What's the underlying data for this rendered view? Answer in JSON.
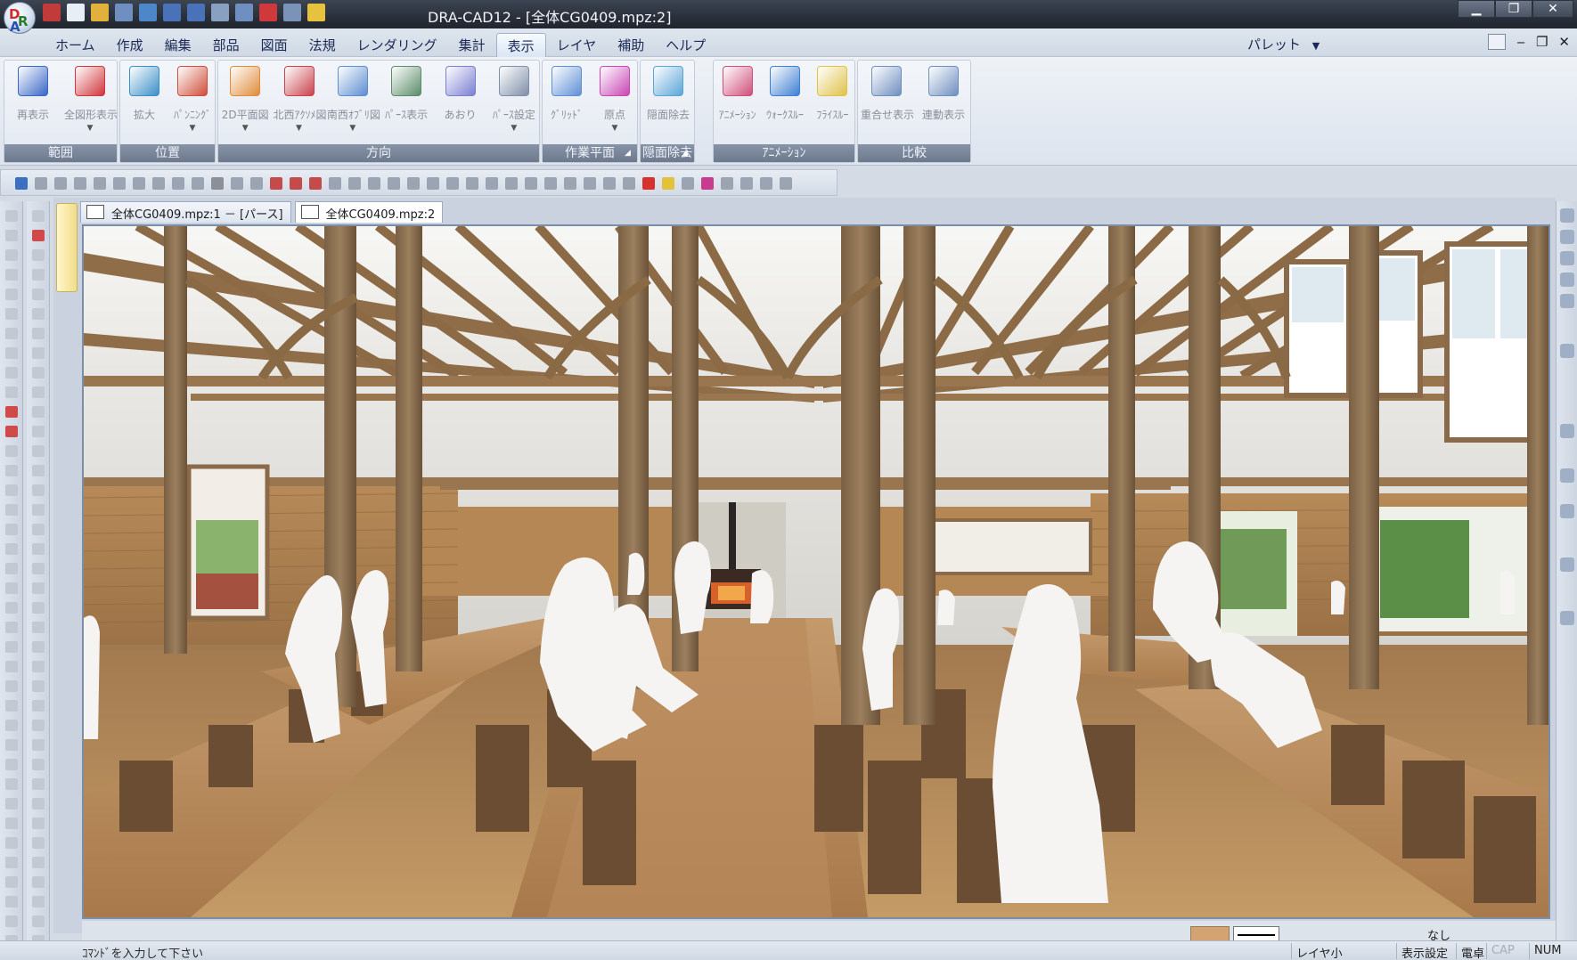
{
  "window": {
    "title": "DRA-CAD12 - [全体CG0409.mpz:2]",
    "logo_letters": [
      "D",
      "R",
      "A"
    ]
  },
  "quick_access": [
    "3d-icon",
    "new-icon",
    "open-icon",
    "save-icon",
    "print-preview-icon",
    "undo-icon",
    "redo-icon",
    "cut-icon",
    "copy-icon",
    "stop-icon",
    "paste-icon",
    "note-icon"
  ],
  "menu": {
    "tabs": [
      "ホーム",
      "作成",
      "編集",
      "部品",
      "図面",
      "法規",
      "レンダリング",
      "集計",
      "表示",
      "レイヤ",
      "補助",
      "ヘルプ"
    ],
    "active_tab": "表示",
    "palette_label": "パレット",
    "palette_arrow": "▼"
  },
  "mdi_controls": {
    "minimize": "‒",
    "restore": "❐",
    "close": "✕"
  },
  "window_controls": {
    "minimize": "▁",
    "maximize": "❐",
    "close": "✕"
  },
  "ribbon": {
    "groups": [
      {
        "label": "範囲",
        "buttons": [
          {
            "label": "再表示",
            "icon": "monitor-blue-icon",
            "color": "#3a67c6",
            "dropdown": false
          },
          {
            "label": "全図形表示",
            "icon": "monitor-red-icon",
            "color": "#d0353b",
            "dropdown": true
          }
        ]
      },
      {
        "label": "位置",
        "buttons": [
          {
            "label": "拡大",
            "icon": "zoom-box-icon",
            "color": "#3b8fc7",
            "dropdown": false
          },
          {
            "label": "ﾊﾟﾝﾆﾝｸﾞ",
            "icon": "pan-arrow-icon",
            "color": "#d04d3a",
            "dropdown": true
          }
        ]
      },
      {
        "label": "方向",
        "buttons": [
          {
            "label": "2D平面図",
            "icon": "2d-plan-icon",
            "color": "#e08c3a",
            "dropdown": true
          },
          {
            "label": "北西ｱｸｿﾒ図",
            "icon": "nw-axonometric-icon",
            "color": "#c9424b",
            "dropdown": true
          },
          {
            "label": "南西ｵﾌﾞﾘ図",
            "icon": "sw-oblique-icon",
            "color": "#5d8ed1",
            "dropdown": true
          },
          {
            "label": "ﾊﾟｰｽ表示",
            "icon": "perspective-icon",
            "color": "#5b8c6a",
            "dropdown": false
          },
          {
            "label": "あおり",
            "icon": "tilt-icon",
            "color": "#7a7fd0",
            "dropdown": false
          },
          {
            "label": "ﾊﾟｰｽ設定",
            "icon": "perspective-settings-icon",
            "color": "#7f8fa8",
            "dropdown": true
          }
        ]
      },
      {
        "label": "作業平面",
        "buttons": [
          {
            "label": "ｸﾞﾘｯﾄﾞ",
            "icon": "grid-icon",
            "color": "#5f8fd6",
            "dropdown": false
          },
          {
            "label": "原点",
            "icon": "origin-axes-icon",
            "color": "#c945b5",
            "dropdown": true
          }
        ]
      },
      {
        "label": "隠面除去",
        "buttons": [
          {
            "label": "隠面除去",
            "icon": "hidden-surface-icon",
            "color": "#5aa5d8",
            "dropdown": false
          }
        ]
      },
      {
        "label": "ｱﾆﾒｰｼｮﾝ",
        "buttons": [
          {
            "label": "ｱﾆﾒｰｼｮﾝ",
            "icon": "animation-camera-icon",
            "color": "#d04f7a",
            "dropdown": false
          },
          {
            "label": "ｳｫｰｸｽﾙｰ",
            "icon": "walkthrough-icon",
            "color": "#3d7fd2",
            "dropdown": false
          },
          {
            "label": "ﾌﾗｲｽﾙｰ",
            "icon": "flythrough-icon",
            "color": "#e0c24a",
            "dropdown": false
          }
        ]
      },
      {
        "label": "比較",
        "buttons": [
          {
            "label": "重合せ表示",
            "icon": "overlay-icon",
            "color": "#6f8fbf",
            "dropdown": false
          },
          {
            "label": "連動表示",
            "icon": "linked-view-icon",
            "color": "#6f8fbf",
            "dropdown": false
          }
        ]
      }
    ]
  },
  "documents": {
    "tabs": [
      {
        "label": "全体CG0409.mpz:1 － [パース]",
        "active": false
      },
      {
        "label": "全体CG0409.mpz:2",
        "active": true
      }
    ]
  },
  "statusbar": {
    "prompt": "ｺﾏﾝﾄﾞを入力して下さい",
    "none_label": "なし",
    "cells": [
      {
        "text": "レイヤ小",
        "dim": false
      },
      {
        "text": "表示設定",
        "dim": false
      },
      {
        "text": "電卓",
        "dim": false
      },
      {
        "text": "CAP",
        "dim": true
      },
      {
        "text": "NUM",
        "dim": false
      }
    ]
  },
  "colors": {
    "layer_color": "#d4a373",
    "accent": "#2a303b"
  }
}
